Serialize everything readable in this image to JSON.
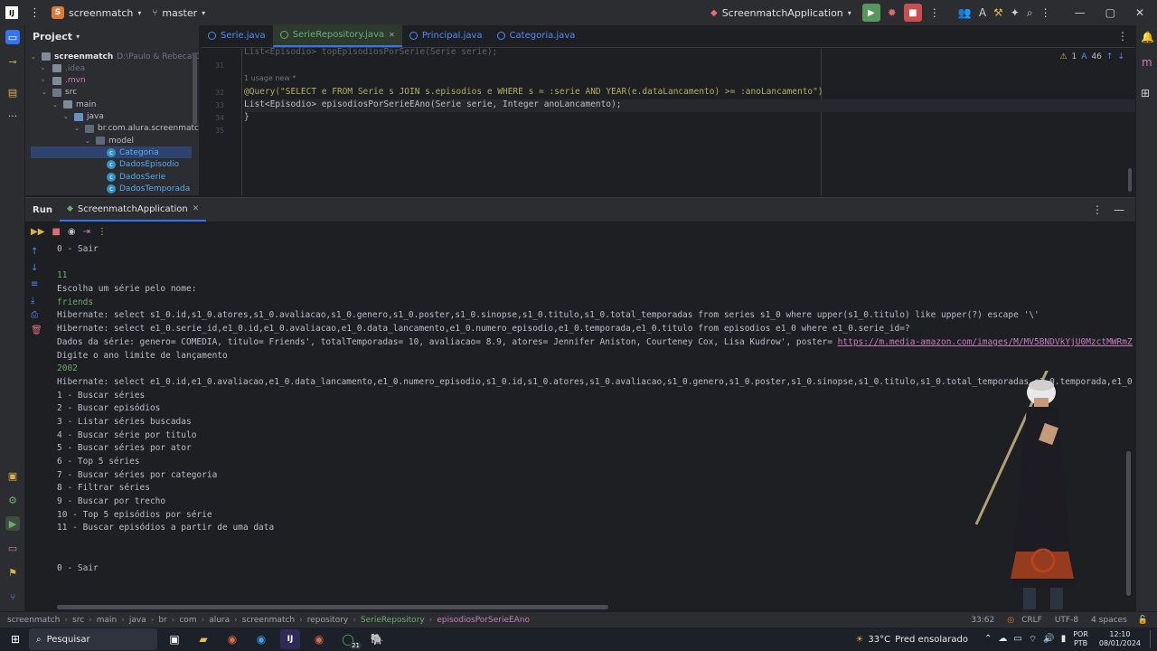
{
  "titlebar": {
    "project": "screenmatch",
    "branch": "master",
    "run_config": "ScreenmatchApplication",
    "project_initial": "S"
  },
  "project_panel": {
    "title": "Project",
    "tree": [
      {
        "label": "screenmatch",
        "path": "D:\\Paulo & Rebeca\\Cruso",
        "indent": 0,
        "type": "folder"
      },
      {
        "label": ".idea",
        "indent": 1,
        "type": "folder"
      },
      {
        "label": ".mvn",
        "indent": 1,
        "type": "folder"
      },
      {
        "label": "src",
        "indent": 1,
        "type": "folder"
      },
      {
        "label": "main",
        "indent": 2,
        "type": "folder"
      },
      {
        "label": "java",
        "indent": 3,
        "type": "folder"
      },
      {
        "label": "br.com.alura.screenmatch",
        "indent": 4,
        "type": "package"
      },
      {
        "label": "model",
        "indent": 5,
        "type": "package"
      },
      {
        "label": "Categoria",
        "indent": 6,
        "type": "class",
        "selected": true
      },
      {
        "label": "DadosEpisodio",
        "indent": 6,
        "type": "class"
      },
      {
        "label": "DadosSerie",
        "indent": 6,
        "type": "class"
      },
      {
        "label": "DadosTemporada",
        "indent": 6,
        "type": "class"
      }
    ]
  },
  "editor": {
    "tabs": [
      {
        "label": "Serie.java",
        "active": false
      },
      {
        "label": "SerieRepository.java",
        "active": true
      },
      {
        "label": "Principal.java",
        "active": false
      },
      {
        "label": "Categoria.java",
        "active": false
      }
    ],
    "warnings": "1",
    "typos": "46",
    "usage_hint": "1 usage   new *",
    "lines": [
      {
        "num": "31",
        "text": ""
      },
      {
        "num": "32",
        "text": ""
      },
      {
        "num": "33",
        "text": ""
      },
      {
        "num": "34",
        "text": ""
      },
      {
        "num": "35",
        "text": ""
      }
    ],
    "code_top": "List<Episodio> topEpisodiosPorSerie(Serie serie);",
    "code_query": "@Query(\"SELECT e FROM Serie s JOIN s.episodios e WHERE s = :serie AND YEAR(e.dataLancamento) >= :anoLancamento\")",
    "code_method": "List<Episodio> episodiosPorSerieEAno(Serie serie, Integer anoLancamento);",
    "code_close": "}"
  },
  "run": {
    "label": "Run",
    "tab": "ScreenmatchApplication",
    "console": [
      {
        "text": "0 - Sair",
        "kind": "out"
      },
      {
        "text": "",
        "kind": "out"
      },
      {
        "text": "11",
        "kind": "input"
      },
      {
        "text": "Escolha um série pelo nome:",
        "kind": "out"
      },
      {
        "text": "friends",
        "kind": "input"
      },
      {
        "text": "Hibernate: select s1_0.id,s1_0.atores,s1_0.avaliacao,s1_0.genero,s1_0.poster,s1_0.sinopse,s1_0.titulo,s1_0.total_temporadas from series s1_0 where upper(s1_0.titulo) like upper(?) escape '\\'",
        "kind": "out"
      },
      {
        "text": "Hibernate: select e1_0.serie_id,e1_0.id,e1_0.avaliacao,e1_0.data_lancamento,e1_0.numero_episodio,e1_0.temporada,e1_0.titulo from episodios e1_0 where e1_0.serie_id=?",
        "kind": "out"
      },
      {
        "text": "Dados da série: genero= COMEDIA, titulo= Friends', totalTemporadas= 10, avaliacao= 8.9, atores= Jennifer Aniston, Courteney Cox, Lisa Kudrow', poster= ",
        "kind": "out",
        "link": "https://m.media-amazon.com/images/M/MV5BNDVkYjU0MzctMWRmZi00NTkxLTgwZWEt"
      },
      {
        "text": "Digite o ano limite de lançamento",
        "kind": "out"
      },
      {
        "text": "2002",
        "kind": "input"
      },
      {
        "text": "Hibernate: select e1_0.id,e1_0.avaliacao,e1_0.data_lancamento,e1_0.numero_episodio,s1_0.id,s1_0.atores,s1_0.avaliacao,s1_0.genero,s1_0.poster,s1_0.sinopse,s1_0.titulo,s1_0.total_temporadas,e1_0.temporada,e1_0.titulo from se",
        "kind": "out"
      },
      {
        "text": "1 - Buscar séries",
        "kind": "out"
      },
      {
        "text": "2 - Buscar episódios",
        "kind": "out"
      },
      {
        "text": "3 - Listar séries buscadas",
        "kind": "out"
      },
      {
        "text": "4 - Buscar série por titulo",
        "kind": "out"
      },
      {
        "text": "5 - Buscar séries por ator",
        "kind": "out"
      },
      {
        "text": "6 - Top 5 séries",
        "kind": "out"
      },
      {
        "text": "7 - Buscar séries por categoria",
        "kind": "out"
      },
      {
        "text": "8 - Filtrar séries",
        "kind": "out"
      },
      {
        "text": "9 - Buscar por trecho",
        "kind": "out"
      },
      {
        "text": "10 - Top 5 episódios por série",
        "kind": "out"
      },
      {
        "text": "11 - Buscar episódios a partir de uma data",
        "kind": "out"
      },
      {
        "text": "",
        "kind": "out"
      },
      {
        "text": "",
        "kind": "out"
      },
      {
        "text": "0 - Sair",
        "kind": "out"
      }
    ]
  },
  "statusbar": {
    "crumbs": [
      "screenmatch",
      "src",
      "main",
      "java",
      "br",
      "com",
      "alura",
      "screenmatch",
      "repository",
      "SerieRepository",
      "episodiosPorSerieEAno"
    ],
    "position": "33:62",
    "line_sep": "CRLF",
    "encoding": "UTF-8",
    "indent": "4 spaces"
  },
  "taskbar": {
    "search_placeholder": "Pesquisar",
    "weather_temp": "33°C",
    "weather_text": "Pred ensolarado",
    "lang_top": "POR",
    "lang_bottom": "PTB",
    "time": "12:10",
    "date": "08/01/2024",
    "whatsapp_badge": "21"
  }
}
